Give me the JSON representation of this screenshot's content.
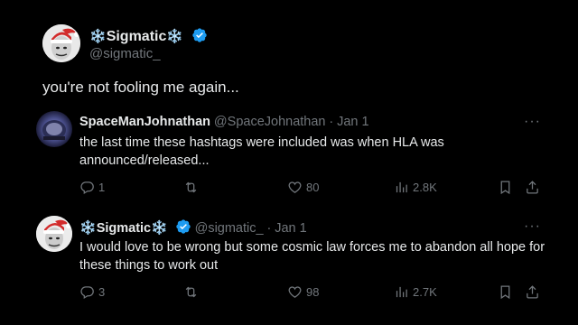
{
  "main_post": {
    "name": "Sigmatic",
    "name_emoji_left": "❄️",
    "name_emoji_right": "❄️",
    "handle": "@sigmatic_",
    "text": "you're not fooling me again..."
  },
  "replies": [
    {
      "name": "SpaceManJohnathan",
      "handle": "@SpaceJohnathan",
      "separator": "·",
      "date": "Jan 1",
      "text": "the last time these hashtags were included was when HLA was announced/released...",
      "replies_count": "1",
      "retweets_count": "",
      "likes_count": "80",
      "views_count": "2.8K",
      "more": "···"
    },
    {
      "name": "Sigmatic",
      "name_emoji_left": "❄️",
      "name_emoji_right": "❄️",
      "handle": "@sigmatic_",
      "separator": "·",
      "date": "Jan 1",
      "text": "I would love to be wrong but some cosmic law forces me to abandon all hope for these things to work out",
      "replies_count": "3",
      "retweets_count": "",
      "likes_count": "98",
      "views_count": "2.7K",
      "more": "···"
    }
  ],
  "icons": {
    "verified": "verified-badge-icon",
    "reply": "reply-icon",
    "retweet": "retweet-icon",
    "like": "heart-icon",
    "views": "views-icon",
    "bookmark": "bookmark-icon",
    "share": "share-icon",
    "more": "more-icon"
  },
  "colors": {
    "background": "#000000",
    "text": "#e7e9ea",
    "secondary": "#71767b",
    "verified": "#1d9bf0"
  }
}
